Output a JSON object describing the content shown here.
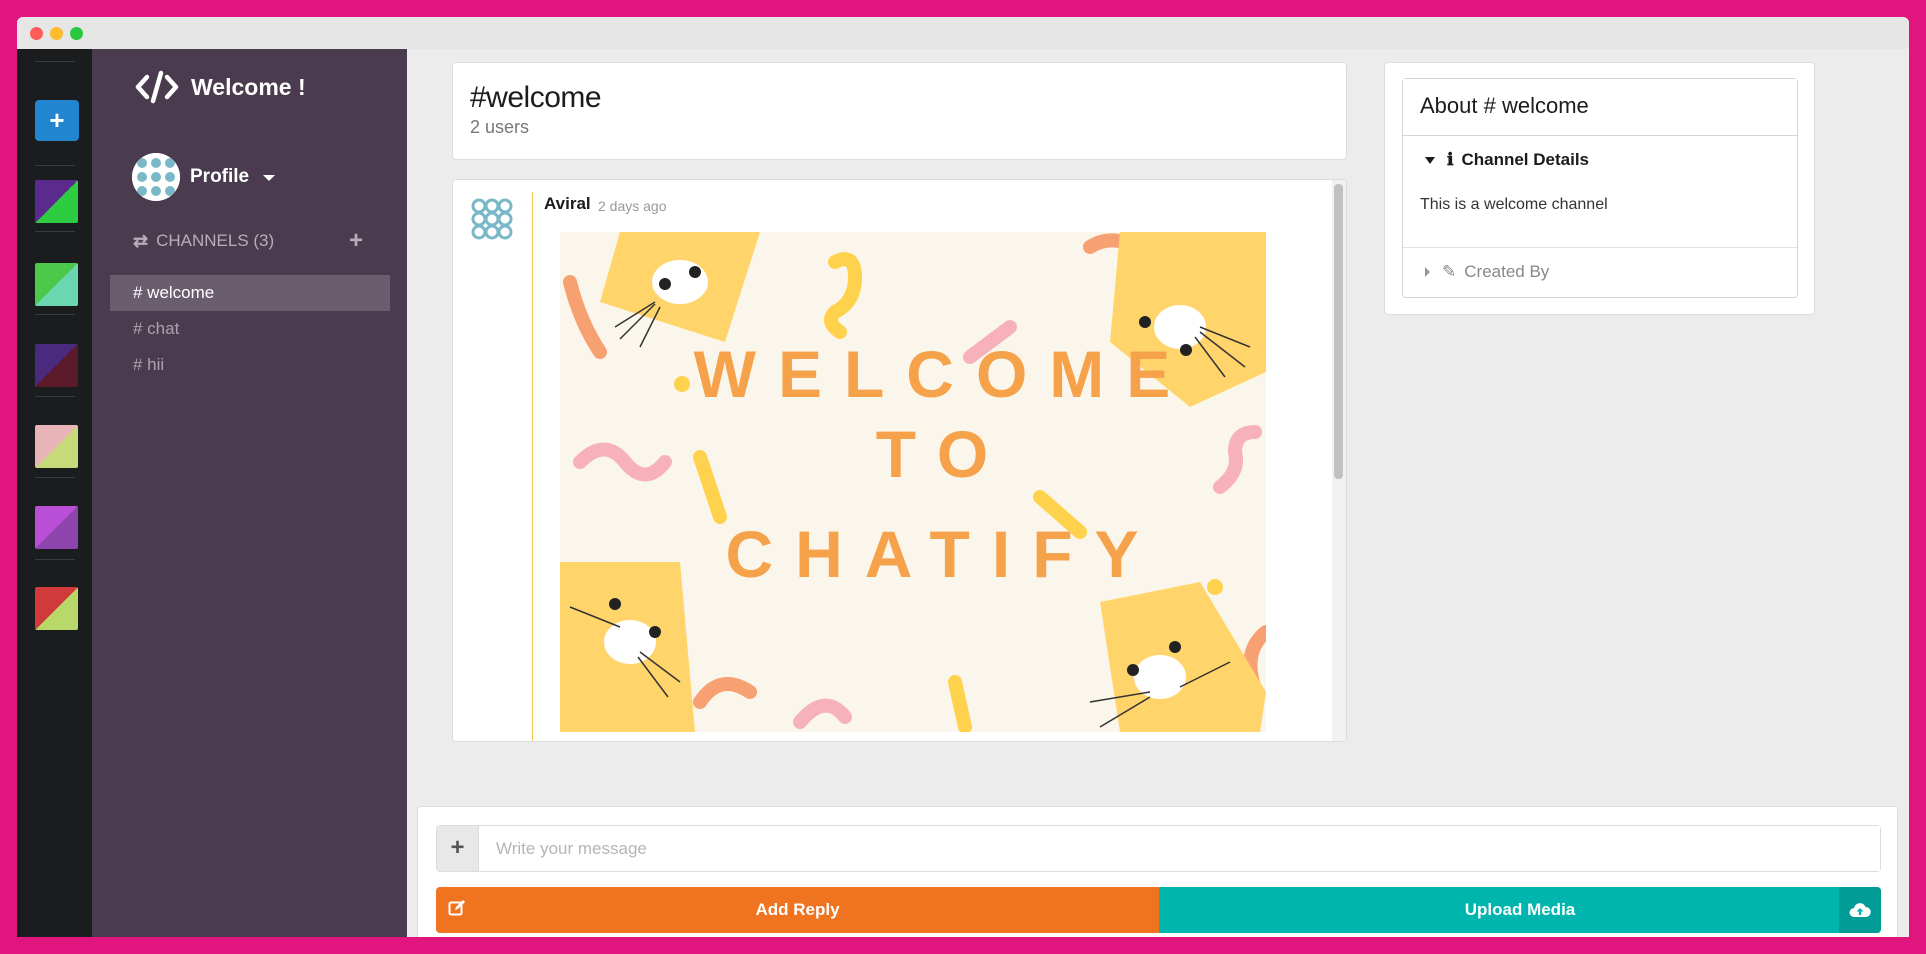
{
  "app": {
    "brand_title": "Welcome !",
    "profile_label": "Profile"
  },
  "rail": {
    "add_symbol": "+",
    "swatches": [
      {
        "a": "#5a2b8c",
        "b": "#2ecc40"
      },
      {
        "a": "#4cc94a",
        "b": "#6ad7b0"
      },
      {
        "a": "#4a2a7c",
        "b": "#5a1a2a"
      },
      {
        "a": "#e8b4b8",
        "b": "#c8d97a"
      },
      {
        "a": "#b84fd6",
        "b": "#8e44ad"
      },
      {
        "a": "#d13a3a",
        "b": "#b8d96a"
      }
    ]
  },
  "sidebar": {
    "channels_heading": "CHANNELS (3)",
    "channels": [
      "# welcome",
      "# chat",
      "# hii"
    ],
    "active_channel": "# welcome"
  },
  "channel_header": {
    "title": "#welcome",
    "users": "2 users"
  },
  "message": {
    "author": "Aviral",
    "timestamp": "2 days ago",
    "image_text": [
      "WELCOME",
      "TO",
      "CHATIFY"
    ]
  },
  "about": {
    "title": "About # welcome",
    "details_label": "Channel Details",
    "details_text": "This is a welcome channel",
    "created_by_label": "Created By"
  },
  "composer": {
    "placeholder": "Write your message",
    "add_reply_label": "Add Reply",
    "upload_label": "Upload Media"
  },
  "colors": {
    "accent_orange": "#f07320",
    "accent_teal": "#00b5ad",
    "sidebar_bg": "#4a3c4e",
    "rail_bg": "#1b1c1d",
    "frame": "#e0157d"
  }
}
